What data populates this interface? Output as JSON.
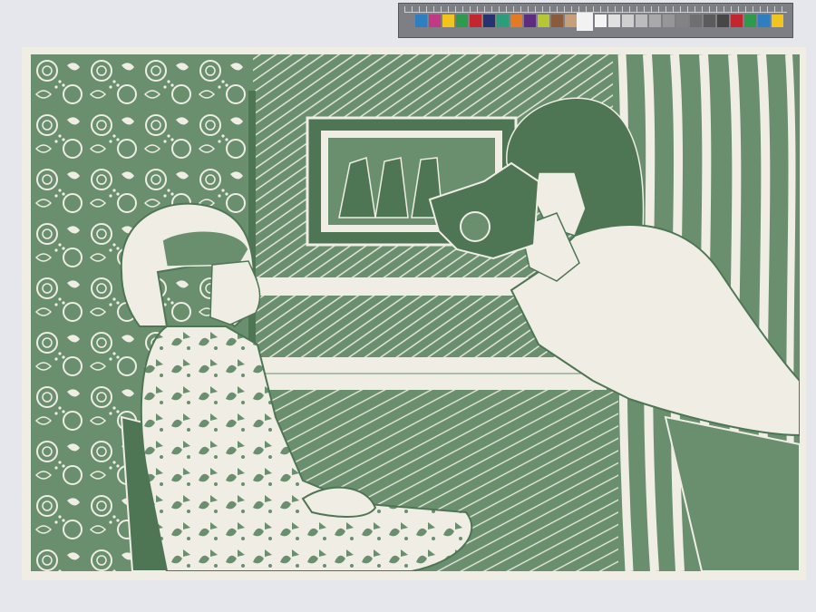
{
  "colors": {
    "ink": "#6a8f6e",
    "ink_dark": "#4e7554",
    "paper": "#efede4",
    "background": "#e6e7ec",
    "card": "#7d7f84"
  },
  "color_card": {
    "label": "",
    "color_patches": [
      "#2e7fc2",
      "#c23a85",
      "#f2c51e",
      "#2e9a4b",
      "#c2262e",
      "#26336f",
      "#2c9d7a",
      "#e17b26",
      "#5f2d7e",
      "#b7c635",
      "#8a5b3c",
      "#c7a07a",
      "#5fa6dc",
      "#3a3a3a"
    ],
    "grey_patches": [
      "#f4f4f4",
      "#e0e0e0",
      "#cfcfcf",
      "#bcbcbc",
      "#a9a9a9",
      "#969696",
      "#838383",
      "#6f6f6f",
      "#5b5b5b",
      "#474747",
      "#c2262e",
      "#2e9a4b",
      "#2e7fc2",
      "#f2c51e"
    ]
  },
  "artwork": {
    "description_hidden": ""
  }
}
